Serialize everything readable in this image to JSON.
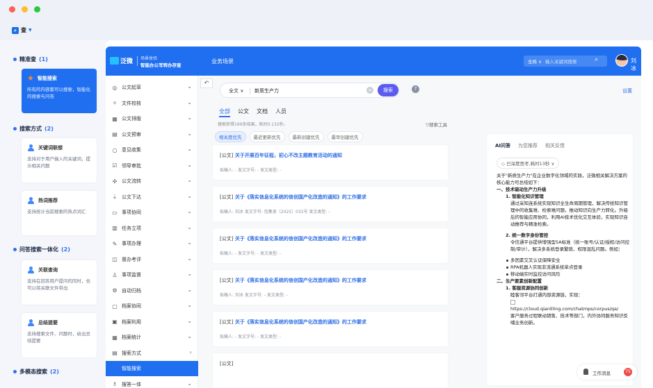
{
  "app_switch": {
    "label": "查"
  },
  "left_panel": {
    "sections": [
      {
        "title": "精准查",
        "count": "(1)",
        "cards": [
          {
            "title": "智能搜索",
            "desc": "所有的内容都可以搜索，智能化的搜索与问答"
          }
        ]
      },
      {
        "title": "搜索方式",
        "count": "(2)",
        "cards": [
          {
            "title": "关键词联想",
            "desc": "支持对于用户输入的关键词，提示相关问题"
          },
          {
            "title": "热词推荐",
            "desc": "支持统计当前搜索的热点词汇"
          }
        ]
      },
      {
        "title": "问答搜索一体化",
        "count": "(2)",
        "cards": [
          {
            "title": "关联查询",
            "desc": "支持在回答用户提问的同时，也可以将关联文件带出"
          },
          {
            "title": "总结提要",
            "desc": "支持搜索文件、问题时，给出总结提要"
          }
        ]
      },
      {
        "title": "多模态搜索",
        "count": "(2)",
        "cards": []
      }
    ]
  },
  "topbar": {
    "logo_text": "泛微",
    "logo_line1": "场景体验",
    "logo_line2": "智能办公写转办存查",
    "nav_item": "业务场景",
    "scope": "全局 ∨",
    "search_placeholder": "输入关键词搜索",
    "user_name": "刘冰"
  },
  "menu": {
    "items": [
      {
        "icon": "◎",
        "icon_name": "target-icon",
        "label": "公文起草"
      },
      {
        "icon": "✧",
        "icon_name": "document-icon",
        "label": "文件校核"
      },
      {
        "icon": "▦",
        "icon_name": "grid-icon",
        "label": "公文排版"
      },
      {
        "icon": "▤",
        "icon_name": "chart-icon",
        "label": "公文预审"
      },
      {
        "icon": "○",
        "icon_name": "inbox-icon",
        "label": "意见收集"
      },
      {
        "icon": "☑",
        "icon_name": "checkbox-icon",
        "label": "领导审批"
      },
      {
        "icon": "✣",
        "icon_name": "flow-icon",
        "label": "公文流转"
      },
      {
        "icon": "⇣",
        "icon_name": "download-icon",
        "label": "公文下达"
      },
      {
        "icon": "▭",
        "icon_name": "monitor-icon",
        "label": "事项协同"
      },
      {
        "icon": "▥",
        "icon_name": "task-icon",
        "label": "任务立项"
      },
      {
        "icon": "✎",
        "icon_name": "edit-icon",
        "label": "事项办理"
      },
      {
        "icon": "◫",
        "icon_name": "evaluate-icon",
        "label": "督办考评"
      },
      {
        "icon": "♙",
        "icon_name": "user-icon",
        "label": "事项监督"
      },
      {
        "icon": "⚙",
        "icon_name": "archive-icon",
        "label": "自动归档"
      },
      {
        "icon": "▢",
        "icon_name": "collab-icon",
        "label": "档案协同"
      },
      {
        "icon": "▣",
        "icon_name": "use-icon",
        "label": "档案利用"
      },
      {
        "icon": "▦",
        "icon_name": "stats-icon",
        "label": "档案统计"
      },
      {
        "icon": "▤",
        "icon_name": "search-mode-icon",
        "label": "搜索方式"
      },
      {
        "icon": "",
        "icon_name": "smart-search-icon",
        "label": "智能搜索"
      },
      {
        "icon": "♗",
        "icon_name": "integration-icon",
        "label": "搜答一体"
      }
    ]
  },
  "search": {
    "scope": "全文 ∨",
    "query": "新质生产力",
    "button": "搜索",
    "help": "?",
    "settings": "设置",
    "back": "↶"
  },
  "tabs": [
    "全部",
    "公文",
    "文档",
    "人员"
  ],
  "stats": "搜索获得169条结果，耗时0.132秒。",
  "tools_label": "▽搜索工具",
  "sort_options": [
    "相关度优先",
    "最近更新优先",
    "最新创建优先",
    "最早创建优先"
  ],
  "results": [
    {
      "prefix": "[公文]",
      "title": "关于开展百年征程，初心不改主题教育活动的通知",
      "meta": "拟稿人: -    发文字号: -    发文类型: -"
    },
    {
      "prefix": "[公文]",
      "title": "关于《落实信息化系统的信创国产化改造的通知》的工作要求",
      "meta": "拟稿人: 刘冰    发文字号: 信集发〔2025〕032号    发文类型: -"
    },
    {
      "prefix": "[公文]",
      "title": "关于《落实信息化系统的信创国产化改造的通知》的工作要求",
      "meta": "拟稿人: -    发文字号: -    发文类型: -"
    },
    {
      "prefix": "[公文]",
      "title": "关于《落实信息化系统的信创国产化改造的通知》的工作要求",
      "meta": "拟稿人: 刘冰    发文字号: -    发文类型: -"
    },
    {
      "prefix": "[公文]",
      "title": "关于《落实信息化系统的信创国产化改造的通知》的工作要求",
      "meta": "拟稿人: -    发文字号: -    发文类型: -"
    },
    {
      "prefix": "[公文]",
      "title": "",
      "meta": ""
    }
  ],
  "ai": {
    "tabs": [
      "AI问答",
      "为您推荐",
      "相关反馈"
    ],
    "thinking": "◇ 已深度思考,耗时13秒 ∨",
    "intro": "关于\"新质生产力\"在企业数字化领域的实践，泛微相关解决方案的核心能力可总结如下：",
    "h1": "一、技术驱动生产力升级",
    "s1_title": "1. 智能化知识管理",
    "s1_body": "通过采知连系统实现知识全生命周期管理，解决传统知识管理中的收集难、检索难问题，推动知识向生产力转化。升级后的智能应用协同，利用AI技术优化交互体验，实现知识自动推荐与精准检索。",
    "s2_title": "2. 统一数字身份管控",
    "s2_body": "令信通平台提供增强型5A标准（统一账号/认证/授权/访问控制/审计），解决多系统登录繁琐、权限混乱问题。例如：",
    "bullets": [
      "多因素交叉认证保障安全",
      "RPA机器人实现非流通系统单点登录",
      "移动端实时监控访问风险"
    ],
    "h2": "二、生产要素创新配置",
    "s3_title": "1. 客服资源协同创新",
    "s3_body": "睦客邻平台打通内部资源链，实现：",
    "link": "https://cloud.qianliling.com/chatmps/corpus/qa/",
    "s3_tail": "客户服务过程联动销售、技术等部门，内外协同服务知识反哺业务创新。"
  },
  "work_msg": {
    "label": "工作消息",
    "badge": "75"
  }
}
